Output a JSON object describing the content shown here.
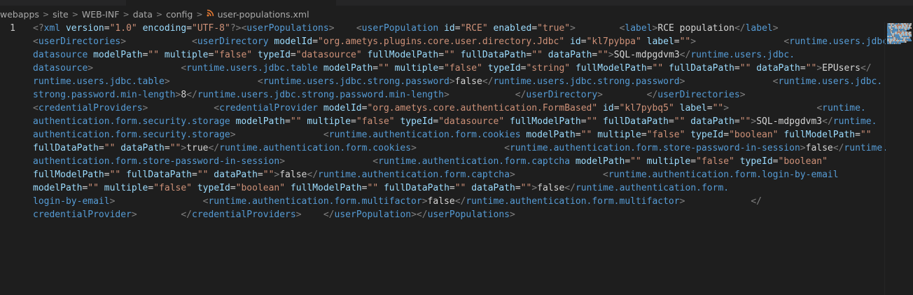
{
  "breadcrumb": {
    "items": [
      "webapps",
      "site",
      "WEB-INF",
      "data",
      "config"
    ],
    "file": "user-populations.xml",
    "separator": ">",
    "file_icon": "rss-icon"
  },
  "editor": {
    "line_number": "1",
    "visual_lines": [
      [
        [
          "b",
          "<?"
        ],
        [
          "t",
          "xml"
        ],
        [
          "x",
          " "
        ],
        [
          "n",
          "version"
        ],
        [
          "x",
          "="
        ],
        [
          "s",
          "\"1.0\""
        ],
        [
          "x",
          " "
        ],
        [
          "n",
          "encoding"
        ],
        [
          "x",
          "="
        ],
        [
          "s",
          "\"UTF-8\""
        ],
        [
          "b",
          "?>"
        ],
        [
          "b",
          "<"
        ],
        [
          "t",
          "userPopulations"
        ],
        [
          "b",
          ">"
        ],
        [
          "x",
          "    "
        ],
        [
          "b",
          "<"
        ],
        [
          "t",
          "userPopulation"
        ],
        [
          "x",
          " "
        ],
        [
          "n",
          "id"
        ],
        [
          "x",
          "="
        ],
        [
          "s",
          "\"RCE\""
        ],
        [
          "x",
          " "
        ],
        [
          "n",
          "enabled"
        ],
        [
          "x",
          "="
        ],
        [
          "s",
          "\"true\""
        ],
        [
          "b",
          ">"
        ],
        [
          "x",
          "        "
        ],
        [
          "b",
          "<"
        ],
        [
          "t",
          "label"
        ],
        [
          "b",
          ">"
        ],
        [
          "x",
          "RCE population"
        ],
        [
          "b",
          "</"
        ],
        [
          "t",
          "label"
        ],
        [
          "b",
          ">"
        ]
      ],
      [
        [
          "b",
          "<"
        ],
        [
          "t",
          "userDirectories"
        ],
        [
          "b",
          ">"
        ],
        [
          "x",
          "            "
        ],
        [
          "b",
          "<"
        ],
        [
          "t",
          "userDirectory"
        ],
        [
          "x",
          " "
        ],
        [
          "n",
          "modelId"
        ],
        [
          "x",
          "="
        ],
        [
          "s",
          "\"org.ametys.plugins.core.user.directory.Jdbc\""
        ],
        [
          "x",
          " "
        ],
        [
          "n",
          "id"
        ],
        [
          "x",
          "="
        ],
        [
          "s",
          "\"kl7pybpa\""
        ],
        [
          "x",
          " "
        ],
        [
          "n",
          "label"
        ],
        [
          "x",
          "="
        ],
        [
          "s",
          "\"\""
        ],
        [
          "b",
          ">"
        ],
        [
          "x",
          "                "
        ],
        [
          "b",
          "<"
        ],
        [
          "t",
          "runtime.users.jdbc."
        ]
      ],
      [
        [
          "t",
          "datasource"
        ],
        [
          "x",
          " "
        ],
        [
          "n",
          "modelPath"
        ],
        [
          "x",
          "="
        ],
        [
          "s",
          "\"\""
        ],
        [
          "x",
          " "
        ],
        [
          "n",
          "multiple"
        ],
        [
          "x",
          "="
        ],
        [
          "s",
          "\"false\""
        ],
        [
          "x",
          " "
        ],
        [
          "n",
          "typeId"
        ],
        [
          "x",
          "="
        ],
        [
          "s",
          "\"datasource\""
        ],
        [
          "x",
          " "
        ],
        [
          "n",
          "fullModelPath"
        ],
        [
          "x",
          "="
        ],
        [
          "s",
          "\"\""
        ],
        [
          "x",
          " "
        ],
        [
          "n",
          "fullDataPath"
        ],
        [
          "x",
          "="
        ],
        [
          "s",
          "\"\""
        ],
        [
          "x",
          " "
        ],
        [
          "n",
          "dataPath"
        ],
        [
          "x",
          "="
        ],
        [
          "s",
          "\"\""
        ],
        [
          "b",
          ">"
        ],
        [
          "x",
          "SQL-mdpgdvm3"
        ],
        [
          "b",
          "</"
        ],
        [
          "t",
          "runtime.users.jdbc."
        ]
      ],
      [
        [
          "t",
          "datasource"
        ],
        [
          "b",
          ">"
        ],
        [
          "x",
          "                "
        ],
        [
          "b",
          "<"
        ],
        [
          "t",
          "runtime.users.jdbc.table"
        ],
        [
          "x",
          " "
        ],
        [
          "n",
          "modelPath"
        ],
        [
          "x",
          "="
        ],
        [
          "s",
          "\"\""
        ],
        [
          "x",
          " "
        ],
        [
          "n",
          "multiple"
        ],
        [
          "x",
          "="
        ],
        [
          "s",
          "\"false\""
        ],
        [
          "x",
          " "
        ],
        [
          "n",
          "typeId"
        ],
        [
          "x",
          "="
        ],
        [
          "s",
          "\"string\""
        ],
        [
          "x",
          " "
        ],
        [
          "n",
          "fullModelPath"
        ],
        [
          "x",
          "="
        ],
        [
          "s",
          "\"\""
        ],
        [
          "x",
          " "
        ],
        [
          "n",
          "fullDataPath"
        ],
        [
          "x",
          "="
        ],
        [
          "s",
          "\"\""
        ],
        [
          "x",
          " "
        ],
        [
          "n",
          "dataPath"
        ],
        [
          "x",
          "="
        ],
        [
          "s",
          "\"\""
        ],
        [
          "b",
          ">"
        ],
        [
          "x",
          "EPUsers"
        ],
        [
          "b",
          "</"
        ]
      ],
      [
        [
          "t",
          "runtime.users.jdbc.table"
        ],
        [
          "b",
          ">"
        ],
        [
          "x",
          "                "
        ],
        [
          "b",
          "<"
        ],
        [
          "t",
          "runtime.users.jdbc.strong.password"
        ],
        [
          "b",
          ">"
        ],
        [
          "x",
          "false"
        ],
        [
          "b",
          "</"
        ],
        [
          "t",
          "runtime.users.jdbc.strong.password"
        ],
        [
          "b",
          ">"
        ],
        [
          "x",
          "                "
        ],
        [
          "b",
          "<"
        ],
        [
          "t",
          "runtime.users.jdbc."
        ]
      ],
      [
        [
          "t",
          "strong.password.min-length"
        ],
        [
          "b",
          ">"
        ],
        [
          "x",
          "8"
        ],
        [
          "b",
          "</"
        ],
        [
          "t",
          "runtime.users.jdbc.strong.password.min-length"
        ],
        [
          "b",
          ">"
        ],
        [
          "x",
          "            "
        ],
        [
          "b",
          "</"
        ],
        [
          "t",
          "userDirectory"
        ],
        [
          "b",
          ">"
        ],
        [
          "x",
          "        "
        ],
        [
          "b",
          "</"
        ],
        [
          "t",
          "userDirectories"
        ],
        [
          "b",
          ">"
        ]
      ],
      [
        [
          "b",
          "<"
        ],
        [
          "t",
          "credentialProviders"
        ],
        [
          "b",
          ">"
        ],
        [
          "x",
          "            "
        ],
        [
          "b",
          "<"
        ],
        [
          "t",
          "credentialProvider"
        ],
        [
          "x",
          " "
        ],
        [
          "n",
          "modelId"
        ],
        [
          "x",
          "="
        ],
        [
          "s",
          "\"org.ametys.core.authentication.FormBased\""
        ],
        [
          "x",
          " "
        ],
        [
          "n",
          "id"
        ],
        [
          "x",
          "="
        ],
        [
          "s",
          "\"kl7pybq5\""
        ],
        [
          "x",
          " "
        ],
        [
          "n",
          "label"
        ],
        [
          "x",
          "="
        ],
        [
          "s",
          "\"\""
        ],
        [
          "b",
          ">"
        ],
        [
          "x",
          "                "
        ],
        [
          "b",
          "<"
        ],
        [
          "t",
          "runtime."
        ]
      ],
      [
        [
          "t",
          "authentication.form.security.storage"
        ],
        [
          "x",
          " "
        ],
        [
          "n",
          "modelPath"
        ],
        [
          "x",
          "="
        ],
        [
          "s",
          "\"\""
        ],
        [
          "x",
          " "
        ],
        [
          "n",
          "multiple"
        ],
        [
          "x",
          "="
        ],
        [
          "s",
          "\"false\""
        ],
        [
          "x",
          " "
        ],
        [
          "n",
          "typeId"
        ],
        [
          "x",
          "="
        ],
        [
          "s",
          "\"datasource\""
        ],
        [
          "x",
          " "
        ],
        [
          "n",
          "fullModelPath"
        ],
        [
          "x",
          "="
        ],
        [
          "s",
          "\"\""
        ],
        [
          "x",
          " "
        ],
        [
          "n",
          "fullDataPath"
        ],
        [
          "x",
          "="
        ],
        [
          "s",
          "\"\""
        ],
        [
          "x",
          " "
        ],
        [
          "n",
          "dataPath"
        ],
        [
          "x",
          "="
        ],
        [
          "s",
          "\"\""
        ],
        [
          "b",
          ">"
        ],
        [
          "x",
          "SQL-mdpgdvm3"
        ],
        [
          "b",
          "</"
        ],
        [
          "t",
          "runtime."
        ]
      ],
      [
        [
          "t",
          "authentication.form.security.storage"
        ],
        [
          "b",
          ">"
        ],
        [
          "x",
          "                "
        ],
        [
          "b",
          "<"
        ],
        [
          "t",
          "runtime.authentication.form.cookies"
        ],
        [
          "x",
          " "
        ],
        [
          "n",
          "modelPath"
        ],
        [
          "x",
          "="
        ],
        [
          "s",
          "\"\""
        ],
        [
          "x",
          " "
        ],
        [
          "n",
          "multiple"
        ],
        [
          "x",
          "="
        ],
        [
          "s",
          "\"false\""
        ],
        [
          "x",
          " "
        ],
        [
          "n",
          "typeId"
        ],
        [
          "x",
          "="
        ],
        [
          "s",
          "\"boolean\""
        ],
        [
          "x",
          " "
        ],
        [
          "n",
          "fullModelPath"
        ],
        [
          "x",
          "="
        ],
        [
          "s",
          "\"\""
        ]
      ],
      [
        [
          "n",
          "fullDataPath"
        ],
        [
          "x",
          "="
        ],
        [
          "s",
          "\"\""
        ],
        [
          "x",
          " "
        ],
        [
          "n",
          "dataPath"
        ],
        [
          "x",
          "="
        ],
        [
          "s",
          "\"\""
        ],
        [
          "b",
          ">"
        ],
        [
          "x",
          "true"
        ],
        [
          "b",
          "</"
        ],
        [
          "t",
          "runtime.authentication.form.cookies"
        ],
        [
          "b",
          ">"
        ],
        [
          "x",
          "                "
        ],
        [
          "b",
          "<"
        ],
        [
          "t",
          "runtime.authentication.form.store-password-in-session"
        ],
        [
          "b",
          ">"
        ],
        [
          "x",
          "false"
        ],
        [
          "b",
          "</"
        ],
        [
          "t",
          "runtime."
        ]
      ],
      [
        [
          "t",
          "authentication.form.store-password-in-session"
        ],
        [
          "b",
          ">"
        ],
        [
          "x",
          "                "
        ],
        [
          "b",
          "<"
        ],
        [
          "t",
          "runtime.authentication.form.captcha"
        ],
        [
          "x",
          " "
        ],
        [
          "n",
          "modelPath"
        ],
        [
          "x",
          "="
        ],
        [
          "s",
          "\"\""
        ],
        [
          "x",
          " "
        ],
        [
          "n",
          "multiple"
        ],
        [
          "x",
          "="
        ],
        [
          "s",
          "\"false\""
        ],
        [
          "x",
          " "
        ],
        [
          "n",
          "typeId"
        ],
        [
          "x",
          "="
        ],
        [
          "s",
          "\"boolean\""
        ]
      ],
      [
        [
          "n",
          "fullModelPath"
        ],
        [
          "x",
          "="
        ],
        [
          "s",
          "\"\""
        ],
        [
          "x",
          " "
        ],
        [
          "n",
          "fullDataPath"
        ],
        [
          "x",
          "="
        ],
        [
          "s",
          "\"\""
        ],
        [
          "x",
          " "
        ],
        [
          "n",
          "dataPath"
        ],
        [
          "x",
          "="
        ],
        [
          "s",
          "\"\""
        ],
        [
          "b",
          ">"
        ],
        [
          "x",
          "false"
        ],
        [
          "b",
          "</"
        ],
        [
          "t",
          "runtime.authentication.form.captcha"
        ],
        [
          "b",
          ">"
        ],
        [
          "x",
          "                "
        ],
        [
          "b",
          "<"
        ],
        [
          "t",
          "runtime.authentication.form.login-by-email"
        ]
      ],
      [
        [
          "n",
          "modelPath"
        ],
        [
          "x",
          "="
        ],
        [
          "s",
          "\"\""
        ],
        [
          "x",
          " "
        ],
        [
          "n",
          "multiple"
        ],
        [
          "x",
          "="
        ],
        [
          "s",
          "\"false\""
        ],
        [
          "x",
          " "
        ],
        [
          "n",
          "typeId"
        ],
        [
          "x",
          "="
        ],
        [
          "s",
          "\"boolean\""
        ],
        [
          "x",
          " "
        ],
        [
          "n",
          "fullModelPath"
        ],
        [
          "x",
          "="
        ],
        [
          "s",
          "\"\""
        ],
        [
          "x",
          " "
        ],
        [
          "n",
          "fullDataPath"
        ],
        [
          "x",
          "="
        ],
        [
          "s",
          "\"\""
        ],
        [
          "x",
          " "
        ],
        [
          "n",
          "dataPath"
        ],
        [
          "x",
          "="
        ],
        [
          "s",
          "\"\""
        ],
        [
          "b",
          ">"
        ],
        [
          "x",
          "false"
        ],
        [
          "b",
          "</"
        ],
        [
          "t",
          "runtime.authentication.form."
        ]
      ],
      [
        [
          "t",
          "login-by-email"
        ],
        [
          "b",
          ">"
        ],
        [
          "x",
          "                "
        ],
        [
          "b",
          "<"
        ],
        [
          "t",
          "runtime.authentication.form.multifactor"
        ],
        [
          "b",
          ">"
        ],
        [
          "x",
          "false"
        ],
        [
          "b",
          "</"
        ],
        [
          "t",
          "runtime.authentication.form.multifactor"
        ],
        [
          "b",
          ">"
        ],
        [
          "x",
          "            "
        ],
        [
          "b",
          "</"
        ]
      ],
      [
        [
          "t",
          "credentialProvider"
        ],
        [
          "b",
          ">"
        ],
        [
          "x",
          "        "
        ],
        [
          "b",
          "</"
        ],
        [
          "t",
          "credentialProviders"
        ],
        [
          "b",
          ">"
        ],
        [
          "x",
          "    "
        ],
        [
          "b",
          "</"
        ],
        [
          "t",
          "userPopulation"
        ],
        [
          "b",
          ">"
        ],
        [
          "b",
          "</"
        ],
        [
          "t",
          "userPopulations"
        ],
        [
          "b",
          ">"
        ]
      ]
    ],
    "colors": {
      "background": "#1e1e1e",
      "tag": "#569cd6",
      "attribute": "#9cdcfe",
      "string": "#ce9178",
      "text": "#d4d4d4",
      "bracket": "#808080"
    }
  }
}
